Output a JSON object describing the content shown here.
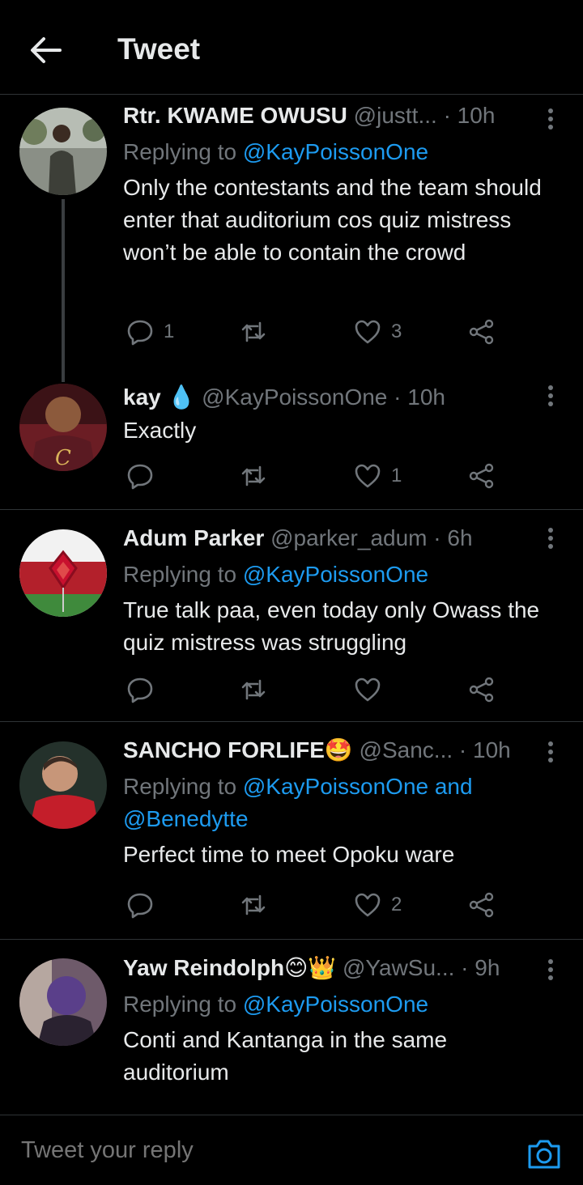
{
  "header": {
    "title": "Tweet"
  },
  "tweets": [
    {
      "name": "Rtr. KWAME OWUSU",
      "handle": "@justt...",
      "time": "· 10h",
      "replying_label": "Replying to ",
      "replying_to": "@KayPoissonOne",
      "text": "Only the contestants and the team should enter that auditorium cos quiz mistress won’t be able to contain the crowd",
      "replies": "1",
      "retweets": "",
      "likes": "3"
    },
    {
      "name": "kay",
      "emoji": "💧",
      "handle": "@KayPoissonOne",
      "time": "· 10h",
      "text": "Exactly",
      "replies": "",
      "retweets": "",
      "likes": "1"
    },
    {
      "name": "Adum Parker",
      "handle": "@parker_adum",
      "time": "· 6h",
      "replying_label": "Replying to ",
      "replying_to": "@KayPoissonOne",
      "text": "True talk paa, even today only Owass the quiz mistress was struggling",
      "replies": "",
      "retweets": "",
      "likes": ""
    },
    {
      "name": "SANCHO FORLIFE",
      "emoji": "🤩",
      "handle": "@Sanc...",
      "time": "· 10h",
      "replying_label": "Replying to ",
      "replying_to": "@KayPoissonOne and @Benedytte",
      "text": "Perfect time to meet Opoku ware",
      "replies": "",
      "retweets": "",
      "likes": "2"
    },
    {
      "name": "Yaw Reindolph",
      "emoji": "😊👑",
      "handle": "@YawSu...",
      "time": "· 9h",
      "replying_label": "Replying to ",
      "replying_to": "@KayPoissonOne",
      "text": "Conti and Kantanga in the same auditorium"
    }
  ],
  "reply_bar": {
    "placeholder": "Tweet your reply"
  },
  "colors": {
    "accent": "#1d9bf0",
    "background": "#000000",
    "muted": "#71767b",
    "divider": "#2f3336"
  }
}
